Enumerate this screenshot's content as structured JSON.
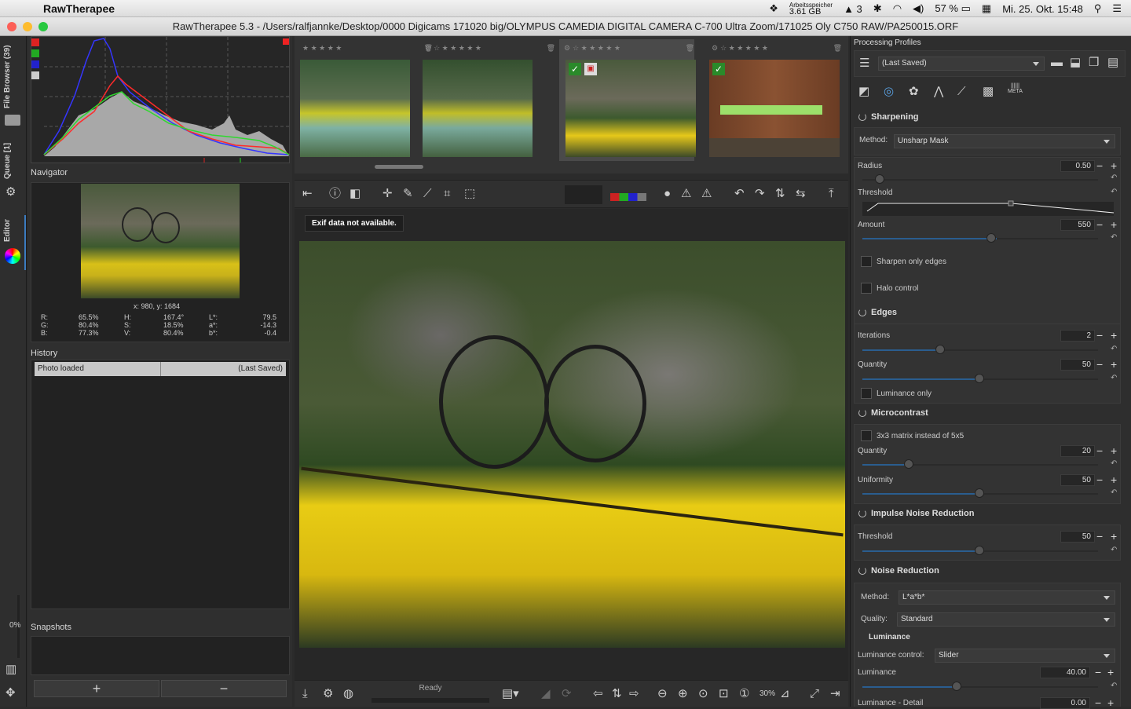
{
  "menubar": {
    "app_name": "RawTherapee",
    "memory_label": "Arbeitsspeicher",
    "memory_value": "3.61 GB",
    "adobe_count": "3",
    "battery": "57 %",
    "datetime": "Mi. 25. Okt.  15:48"
  },
  "window": {
    "title": "RawTherapee 5.3 - /Users/ralfjannke/Desktop/0000 Digicams 171020 big/OLYMPUS CAMEDIA DIGITAL CAMERA C-700 Ultra Zoom/171025 Oly C750 RAW/PA250015.ORF"
  },
  "side_tabs": {
    "file_browser": "File Browser (39)",
    "queue": "Queue [1]",
    "editor": "Editor",
    "percent": "0%"
  },
  "navigator": {
    "title": "Navigator",
    "coords": "x: 980, y: 1684",
    "r_label": "R:",
    "r_val": "65.5%",
    "g_label": "G:",
    "g_val": "80.4%",
    "b_label": "B:",
    "b_val": "77.3%",
    "h_label": "H:",
    "h_val": "167.4°",
    "s_label": "S:",
    "s_val": "18.5%",
    "v_label": "V:",
    "v_val": "80.4%",
    "l_label": "L*:",
    "l_val": "79.5",
    "a_label": "a*:",
    "a_val": "-14.3",
    "bb_label": "b*:",
    "bb_val": "-0.4"
  },
  "history": {
    "title": "History",
    "col1": "Photo loaded",
    "col2": "(Last Saved)"
  },
  "snapshots": {
    "title": "Snapshots",
    "add": "+",
    "remove": "−"
  },
  "preview": {
    "exif_message": "Exif data not available.",
    "status": "Ready",
    "zoom": "30%"
  },
  "right": {
    "profiles_title": "Processing Profiles",
    "profile_value": "(Last Saved)",
    "meta_label": "META",
    "sharpening": {
      "title": "Sharpening",
      "method_label": "Method:",
      "method_value": "Unsharp Mask",
      "radius_label": "Radius",
      "radius_value": "0.50",
      "threshold_label": "Threshold",
      "amount_label": "Amount",
      "amount_value": "550",
      "edges_only": "Sharpen only edges",
      "halo": "Halo control"
    },
    "edges": {
      "title": "Edges",
      "iterations_label": "Iterations",
      "iterations_value": "2",
      "quantity_label": "Quantity",
      "quantity_value": "50",
      "luminance_only": "Luminance only"
    },
    "microcontrast": {
      "title": "Microcontrast",
      "matrix": "3x3 matrix instead of 5x5",
      "quantity_label": "Quantity",
      "quantity_value": "20",
      "uniformity_label": "Uniformity",
      "uniformity_value": "50"
    },
    "impulse": {
      "title": "Impulse Noise Reduction",
      "threshold_label": "Threshold",
      "threshold_value": "50"
    },
    "noise": {
      "title": "Noise Reduction",
      "method_label": "Method:",
      "method_value": "L*a*b*",
      "quality_label": "Quality:",
      "quality_value": "Standard",
      "luminance_section": "Luminance",
      "lum_control_label": "Luminance control:",
      "lum_control_value": "Slider",
      "luminance_label": "Luminance",
      "luminance_value": "40.00",
      "lum_detail_label": "Luminance - Detail",
      "lum_detail_value": "0.00"
    }
  }
}
